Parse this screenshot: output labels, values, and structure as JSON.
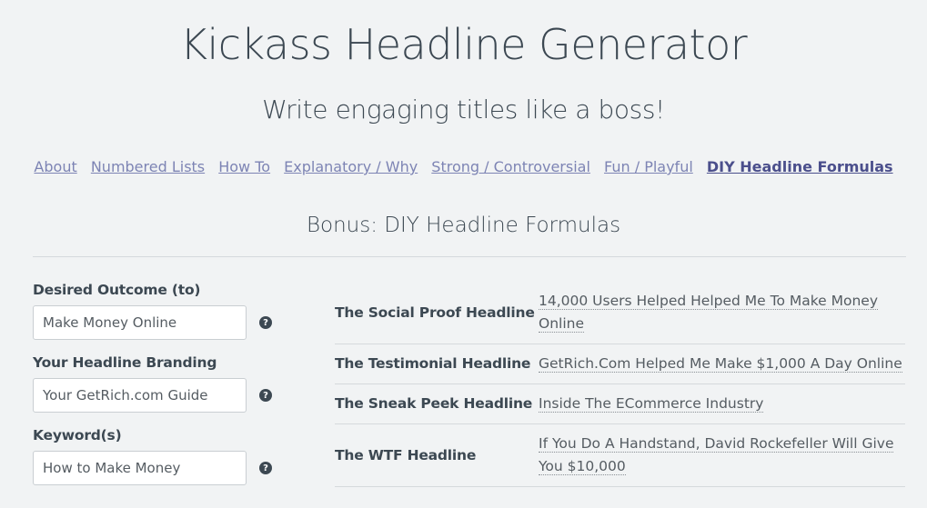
{
  "header": {
    "title": "Kickass Headline Generator",
    "subtitle": "Write engaging titles like a boss!"
  },
  "nav": {
    "items": [
      {
        "label": "About"
      },
      {
        "label": "Numbered Lists"
      },
      {
        "label": "How To"
      },
      {
        "label": "Explanatory / Why"
      },
      {
        "label": "Strong / Controversial"
      },
      {
        "label": "Fun / Playful"
      },
      {
        "label": "DIY Headline Formulas",
        "active": true
      }
    ]
  },
  "section": {
    "title": "Bonus: DIY Headline Formulas"
  },
  "form": {
    "fields": [
      {
        "label": "Desired Outcome (to)",
        "value": "Make Money Online",
        "help_icon": "question-circle-icon"
      },
      {
        "label": "Your Headline Branding",
        "value": "Your GetRich.com Guide",
        "help_icon": "question-circle-icon"
      },
      {
        "label": "Keyword(s)",
        "value": "How to Make Money",
        "help_icon": "question-circle-icon"
      }
    ],
    "help_glyph": "?"
  },
  "headlines": [
    {
      "name": "The Social Proof Headline",
      "text": "14,000 Users Helped Helped Me To Make Money Online"
    },
    {
      "name": "The Testimonial Headline",
      "text": "GetRich.Com Helped Me Make $1,000 A Day Online"
    },
    {
      "name": "The Sneak Peek Headline",
      "text": "Inside The ECommerce Industry"
    },
    {
      "name": "The WTF Headline",
      "text": "If You Do A Handstand, David Rockefeller Will Give You $10,000"
    }
  ]
}
